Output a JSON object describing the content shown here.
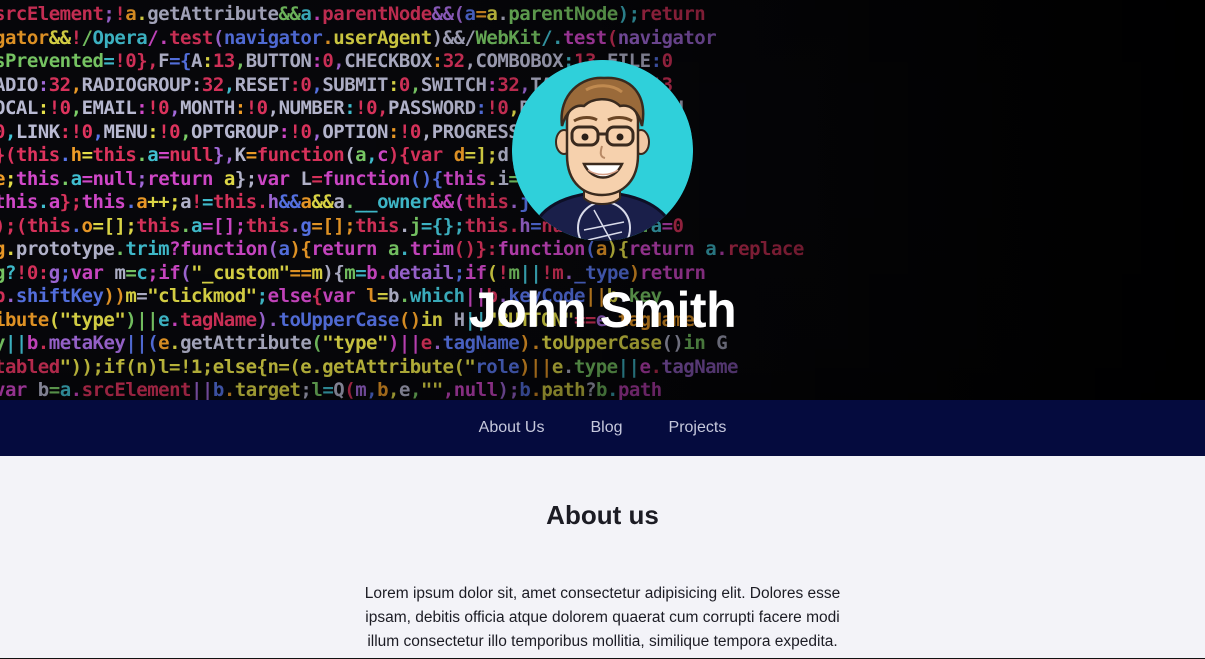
{
  "hero": {
    "name": "John Smith",
    "background_code_lines": [
      "srcElement;!a.getAttribute&&a.parentNode&&(a=a.parentNode);return",
      "gator&&!/Opera/.test(navigator.userAgent)&&/WebKit/.test(navigator",
      "sPrevented=!0},F={A:13,BUTTON:0,CHECKBOX:32,COMBOBOX:13,FILE:0",
      "ADIO:32,RADIOGROUP:32,RESET:0,SUBMIT:0,SWITCH:32,TAB:0,TREE:13",
      "OCAL\":!0,EMAIL:!0,MONTH:!0,NUMBER:!0,PASSWORD:!0,RANGE:!0,SEARCH",
      "0,LINK:!0,MENU:!0,OPTGROUP:!0,OPTION:!0,PROGRESS:!0,RADIO:!0",
      "}(this.h=this.a=null},K=function(a,c){var d=];d.a=a;d.h=c}",
      "e;this.a=null;return a};var L=function(){this.i=[];this.h=null",
      "this.a};this.a++;a!=this.h&&a&&a.__owner&&(this.j=!0,a.__owner",
      ");(this.o=[];this.a=[];this.g=[];this.j={};this.h=null;this.a=0",
      "g.prototype.trim?function(a){return a.trim()}:function(a){return a.replace",
      "g?!0:g;var m=c;if(\"_custom\"==m){m=b.detail;if(!m||!m._type)return",
      "b.shiftKey))m=\"clickmod\";else{var l=b.which||b.keyCode||b.key",
      "ibute(\"type\")||e.tagName).toUpperCase()in H||\"BUTTON\"==e.tagName",
      "y||b.metaKey||(e.getAttribute(\"type\")||e.tagName).toUpperCase()in G",
      "tabled\"));if(n)l=!1;else{n=(e.getAttribute(\"role\")||e.type||e.tagName",
      "var b=a.srcElement||b.target;l=Q(m,b,e,\"\",null);b.path?b.path"
    ]
  },
  "nav": {
    "items": [
      {
        "label": "About Us"
      },
      {
        "label": "Blog"
      },
      {
        "label": "Projects"
      }
    ]
  },
  "about": {
    "title": "About us",
    "body": "Lorem ipsum dolor sit, amet consectetur adipisicing elit. Dolores esse ipsam, debitis officia atque dolorem quaerat cum corrupti facere modi illum consectetur illo temporibus mollitia, similique tempora expedita."
  },
  "colors": {
    "nav_background": "#050b3e",
    "avatar_background": "#2fd0da",
    "content_background": "#f3f3f8"
  }
}
